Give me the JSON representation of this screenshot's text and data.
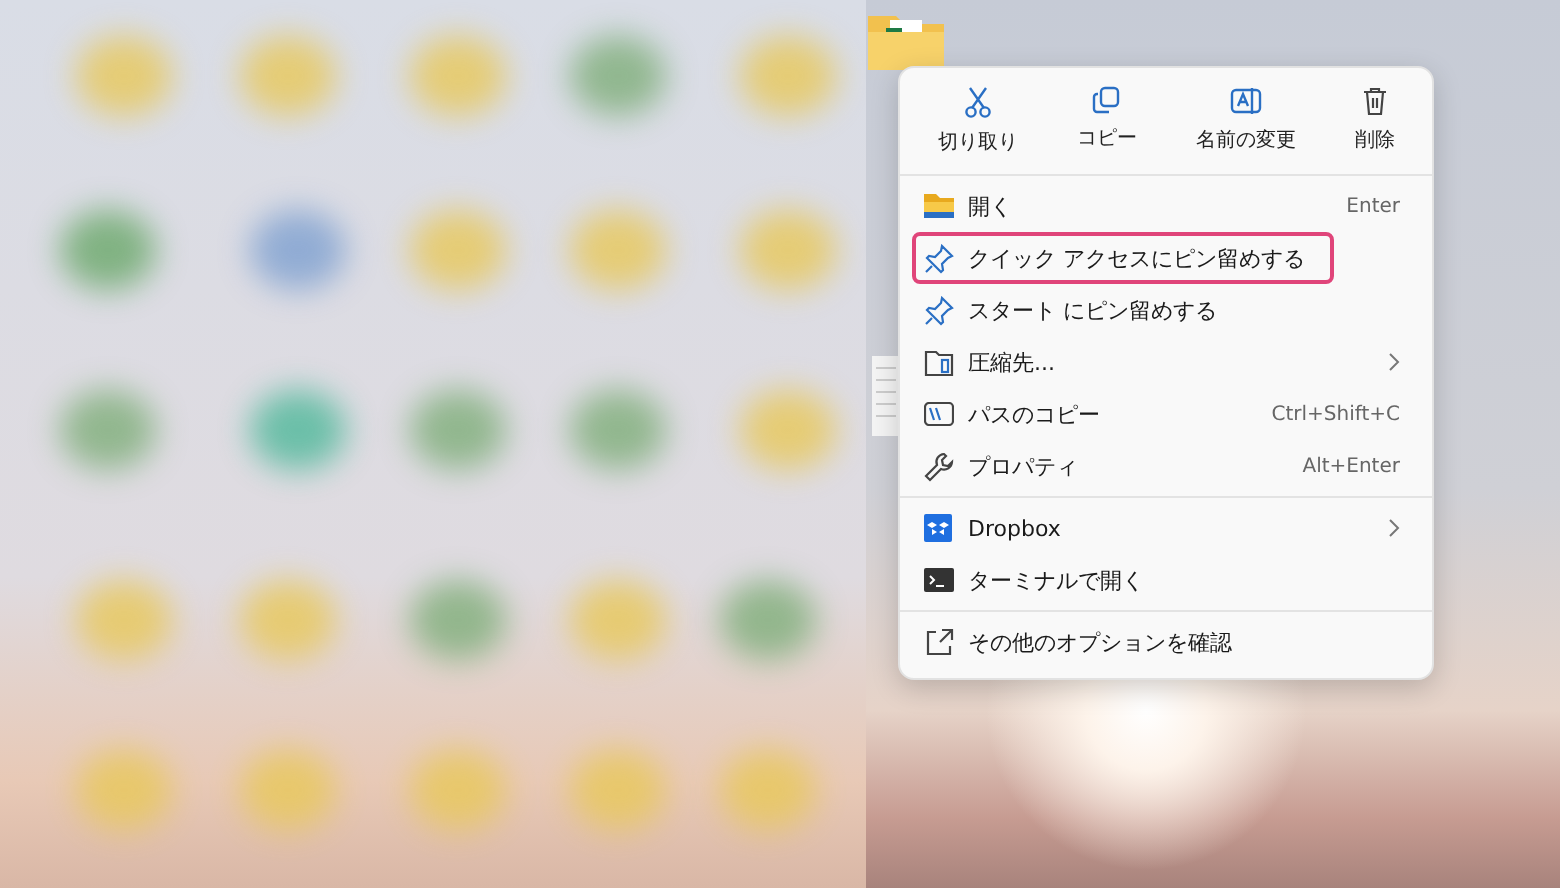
{
  "toolbar": [
    {
      "kind": "cut",
      "label": "切り取り"
    },
    {
      "kind": "copy",
      "label": "コピー"
    },
    {
      "kind": "rename",
      "label": "名前の変更"
    },
    {
      "kind": "delete",
      "label": "削除"
    }
  ],
  "menu_groups": [
    [
      {
        "kind": "folder",
        "label": "開く",
        "shortcut": "Enter",
        "has_submenu": false,
        "highlighted": false
      },
      {
        "kind": "pin",
        "label": "クイック アクセスにピン留めする",
        "has_submenu": false,
        "highlighted": true
      },
      {
        "kind": "pin",
        "label": "スタート にピン留めする",
        "has_submenu": false,
        "highlighted": false
      },
      {
        "kind": "zip",
        "label": "圧縮先...",
        "has_submenu": true,
        "highlighted": false
      },
      {
        "kind": "path",
        "label": "パスのコピー",
        "shortcut": "Ctrl+Shift+C",
        "has_submenu": false,
        "highlighted": false
      },
      {
        "kind": "wrench",
        "label": "プロパティ",
        "shortcut": "Alt+Enter",
        "has_submenu": false,
        "highlighted": false
      }
    ],
    [
      {
        "kind": "dropbox",
        "label": "Dropbox",
        "has_submenu": true,
        "highlighted": false
      },
      {
        "kind": "terminal",
        "label": "ターミナルで開く",
        "has_submenu": false,
        "highlighted": false
      }
    ],
    [
      {
        "kind": "more",
        "label": "その他のオプションを確認",
        "has_submenu": false,
        "highlighted": false
      }
    ]
  ]
}
